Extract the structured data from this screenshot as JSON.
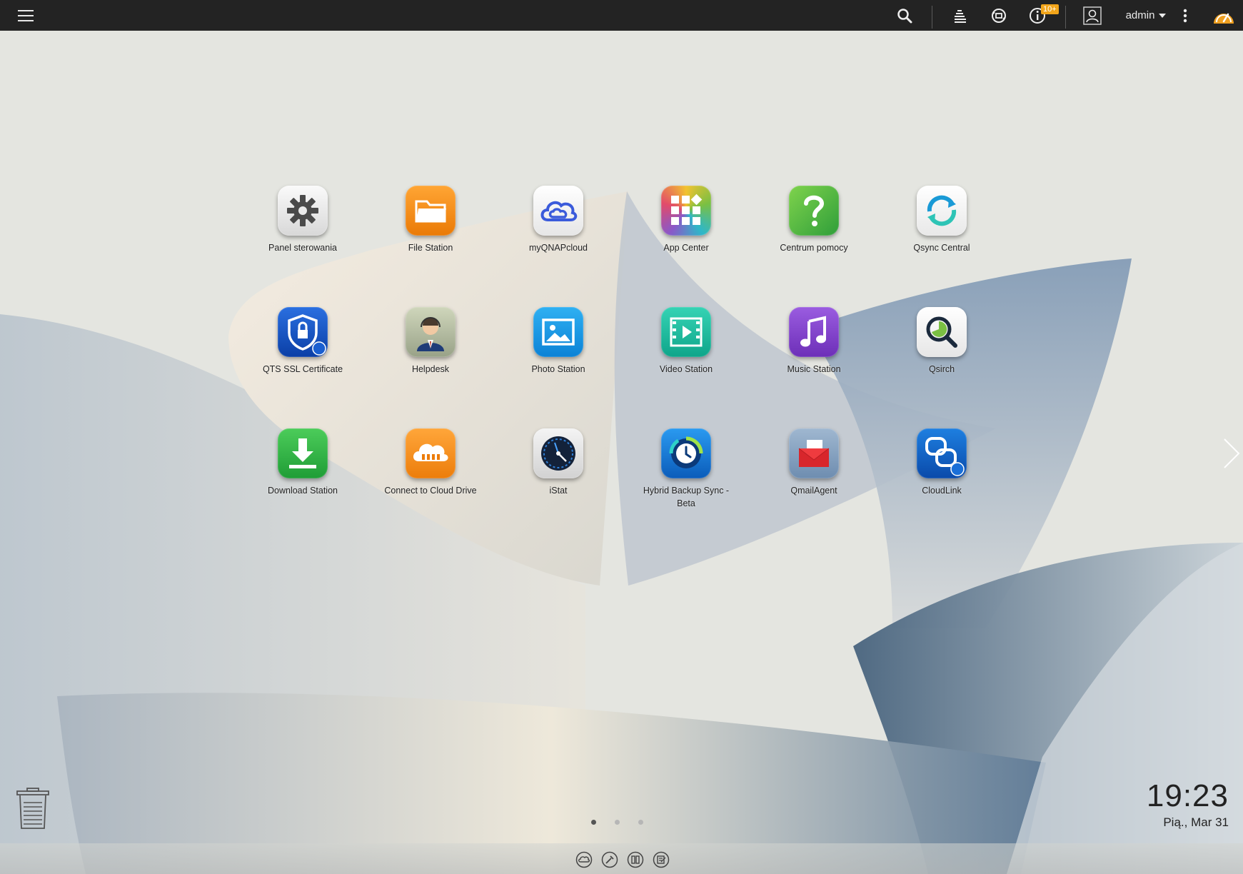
{
  "topbar": {
    "menu_icon": "hamburger-menu-icon",
    "search_icon": "search-icon",
    "tasks_icon": "background-tasks-icon",
    "backup_icon": "external-device-icon",
    "notifications_icon": "event-notifications-icon",
    "notifications_badge": "10+",
    "user_icon": "user-avatar-icon",
    "user_name": "admin",
    "more_icon": "vertical-more-icon",
    "dashboard_icon": "dashboard-gauge-icon"
  },
  "apps": [
    {
      "label": "Panel sterowania",
      "icon": "gear-icon",
      "color": "#e6e6e6"
    },
    {
      "label": "File Station",
      "icon": "folder-icon",
      "color": "#f28a12"
    },
    {
      "label": "myQNAPcloud",
      "icon": "cloud-icon",
      "color": "#ffffff"
    },
    {
      "label": "App Center",
      "icon": "grid-icon",
      "color": "#ffffff"
    },
    {
      "label": "Centrum pomocy",
      "icon": "question-mark-icon",
      "color": "#5cc04a"
    },
    {
      "label": "Qsync Central",
      "icon": "sync-arrows-icon",
      "color": "#ffffff"
    },
    {
      "label": "QTS SSL Certificate",
      "icon": "shield-lock-icon",
      "color": "#1856c8"
    },
    {
      "label": "Helpdesk",
      "icon": "support-agent-icon",
      "color": "#b9c1a6"
    },
    {
      "label": "Photo Station",
      "icon": "photo-icon",
      "color": "#1a9be8"
    },
    {
      "label": "Video Station",
      "icon": "film-icon",
      "color": "#1bbfa0"
    },
    {
      "label": "Music Station",
      "icon": "music-note-icon",
      "color": "#8446c9"
    },
    {
      "label": "Qsirch",
      "icon": "magnifier-icon",
      "color": "#ffffff"
    },
    {
      "label": "Download Station",
      "icon": "download-arrow-icon",
      "color": "#34b54a"
    },
    {
      "label": "Connect to Cloud Drive",
      "icon": "cloud-drive-icon",
      "color": "#f5901a"
    },
    {
      "label": "iStat",
      "icon": "speedometer-icon",
      "color": "#e8e8e8"
    },
    {
      "label": "Hybrid Backup Sync - Beta",
      "icon": "backup-clock-icon",
      "color": "#1a7fd6"
    },
    {
      "label": "QmailAgent",
      "icon": "mail-envelope-icon",
      "color": "#8aa6c4"
    },
    {
      "label": "CloudLink",
      "icon": "cloudlink-icon",
      "color": "#1665c8"
    }
  ],
  "clock": {
    "time": "19:23",
    "date": "Pią., Mar 31"
  },
  "pages": {
    "count": 3,
    "active": 0
  },
  "dock": {
    "icons": [
      "myqnapcloud-dock-icon",
      "tools-dock-icon",
      "library-dock-icon",
      "notes-dock-icon"
    ]
  },
  "trash_icon": "recycle-bin-icon",
  "next_page_icon": "chevron-right-icon"
}
